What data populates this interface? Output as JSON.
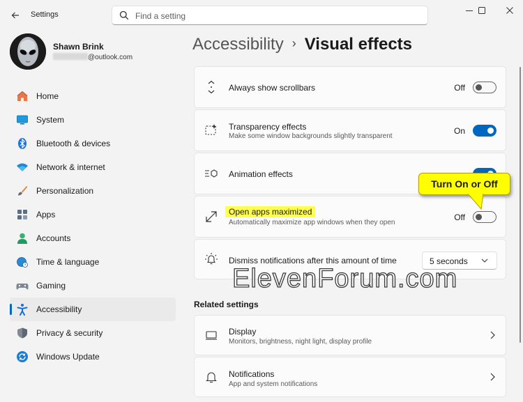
{
  "window": {
    "title": "Settings"
  },
  "search": {
    "placeholder": "Find a setting"
  },
  "user": {
    "name": "Shawn Brink",
    "email_domain": "@outlook.com"
  },
  "nav": [
    {
      "label": "Home",
      "icon": "home-icon"
    },
    {
      "label": "System",
      "icon": "system-monitor-icon"
    },
    {
      "label": "Bluetooth & devices",
      "icon": "bluetooth-icon"
    },
    {
      "label": "Network & internet",
      "icon": "wifi-icon"
    },
    {
      "label": "Personalization",
      "icon": "brush-icon"
    },
    {
      "label": "Apps",
      "icon": "apps-icon"
    },
    {
      "label": "Accounts",
      "icon": "person-icon"
    },
    {
      "label": "Time & language",
      "icon": "globe-clock-icon"
    },
    {
      "label": "Gaming",
      "icon": "gamepad-icon"
    },
    {
      "label": "Accessibility",
      "icon": "accessibility-icon",
      "active": true
    },
    {
      "label": "Privacy & security",
      "icon": "shield-icon"
    },
    {
      "label": "Windows Update",
      "icon": "update-icon"
    }
  ],
  "breadcrumb": {
    "parent": "Accessibility",
    "separator": "›",
    "current": "Visual effects"
  },
  "settings": {
    "scrollbars": {
      "title": "Always show scrollbars",
      "state": "Off",
      "on": false
    },
    "transparency": {
      "title": "Transparency effects",
      "subtitle": "Make some window backgrounds slightly transparent",
      "state": "On",
      "on": true
    },
    "animation": {
      "title": "Animation effects",
      "on": true
    },
    "maximized": {
      "title": "Open apps maximized",
      "subtitle": "Automatically maximize app windows when they open",
      "state": "Off",
      "on": false
    },
    "notifications": {
      "title": "Dismiss notifications after this amount of time",
      "value": "5 seconds"
    }
  },
  "related": {
    "heading": "Related settings",
    "display": {
      "title": "Display",
      "subtitle": "Monitors, brightness, night light, display profile"
    },
    "notifications": {
      "title": "Notifications",
      "subtitle": "App and system notifications"
    }
  },
  "callout": {
    "text": "Turn On or Off"
  },
  "watermark": {
    "text": "ElevenForum.com"
  },
  "colors": {
    "accent": "#0067c0",
    "highlight": "#ffff4d",
    "callout": "#ffff00"
  }
}
